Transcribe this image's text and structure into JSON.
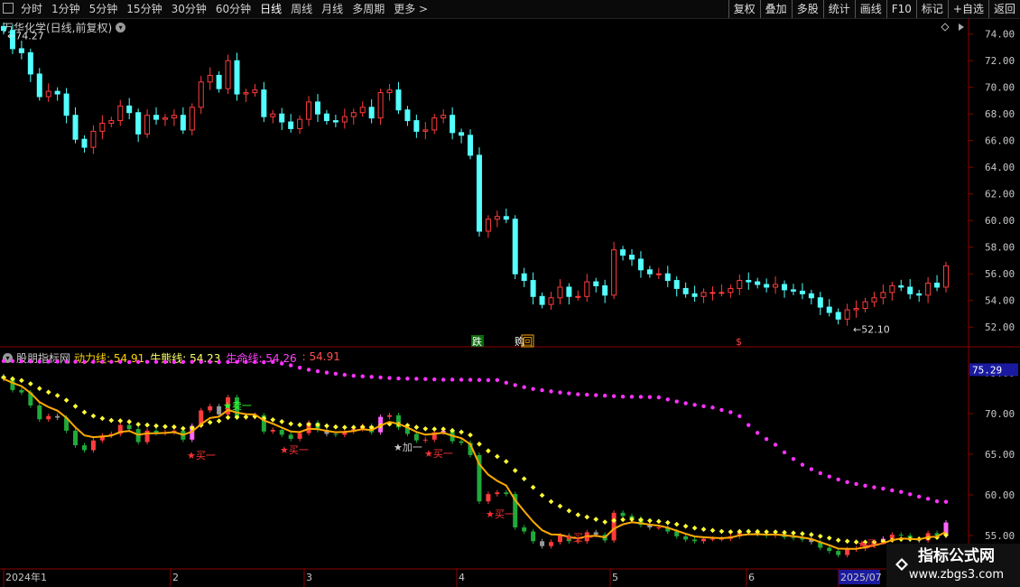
{
  "toolbar": {
    "periods": [
      "分时",
      "1分钟",
      "5分钟",
      "15分钟",
      "30分钟",
      "60分钟",
      "日线",
      "周线",
      "月线",
      "多周期",
      "更多"
    ],
    "active": "日线",
    "more_symbol": ">",
    "actions": [
      "复权",
      "叠加",
      "多股",
      "统计",
      "画线",
      "F10",
      "标记",
      "+自选",
      "返回"
    ]
  },
  "main_pane": {
    "stock_name": "万华化学(日线,前复权)",
    "high_label": "74.27",
    "low_label": "52.10",
    "markers": [
      "跌",
      "购",
      "回",
      "$"
    ],
    "y_ticks": [
      "74.00",
      "72.00",
      "70.00",
      "68.00",
      "66.00",
      "64.00",
      "62.00",
      "60.00",
      "58.00",
      "56.00",
      "54.00",
      "52.00"
    ]
  },
  "indicator_pane": {
    "name": "股朋指标网",
    "lines": [
      {
        "label": "动力线:",
        "value": "54.91",
        "color": "#ffd700"
      },
      {
        "label": "牛熊线:",
        "value": "54.23",
        "color": "#ffff66"
      },
      {
        "label": "生命线:",
        "value": "54.26",
        "color": "#ff40ff"
      },
      {
        "label": ":",
        "value": "54.91",
        "color": "#ff4d4d"
      }
    ],
    "current_value": "75.29",
    "y_ticks": [
      "75.00",
      "70.00",
      "65.00",
      "60.00",
      "55.00"
    ],
    "signals": {
      "sell": "卖一",
      "buy": "买一",
      "add": "加一",
      "sell_star": "★",
      "buy_star": "★"
    }
  },
  "x_axis": {
    "labels": [
      "2024年1",
      "2",
      "3",
      "4",
      "5",
      "6",
      "2025/07"
    ]
  },
  "watermark": {
    "title": "指标公式网",
    "url": "www.zbgs3.com"
  },
  "colors": {
    "up": "#ff3c3c",
    "down": "#54ffff",
    "axis": "#8b0000",
    "dynamic": "#ffaa00",
    "bull": "#ffff33",
    "life": "#ff33ff"
  },
  "chart_data": {
    "type": "candlestick",
    "ylim_price": [
      51.2,
      75.2
    ],
    "ylim_indicator": [
      52,
      76
    ],
    "candles_close": [
      74.27,
      72.9,
      72.6,
      71.0,
      69.3,
      69.7,
      69.5,
      67.9,
      66.1,
      65.5,
      66.7,
      67.3,
      67.5,
      68.6,
      68.1,
      66.5,
      67.9,
      67.6,
      67.7,
      67.9,
      66.8,
      68.5,
      70.4,
      70.9,
      69.9,
      72.0,
      69.5,
      69.6,
      69.8,
      67.8,
      68.0,
      67.4,
      66.9,
      67.6,
      68.9,
      68.0,
      67.5,
      67.4,
      67.8,
      68.1,
      68.5,
      67.7,
      69.6,
      69.8,
      68.3,
      67.5,
      66.7,
      66.8,
      67.7,
      67.9,
      66.6,
      66.4,
      64.9,
      59.2,
      60.1,
      60.3,
      60.1,
      56.0,
      55.5,
      54.3,
      53.7,
      54.2,
      55.0,
      54.3,
      54.3,
      55.4,
      55.1,
      54.4,
      57.8,
      57.4,
      57.1,
      56.3,
      56.0,
      56.0,
      55.5,
      54.9,
      54.5,
      54.3,
      54.6,
      54.6,
      54.6,
      54.9,
      55.5,
      55.4,
      55.2,
      55.0,
      55.2,
      54.8,
      54.7,
      54.5,
      54.2,
      53.5,
      53.1,
      52.6,
      53.3,
      53.4,
      53.9,
      54.2,
      54.6,
      55.1,
      55.0,
      54.5,
      54.4,
      55.3,
      55.0,
      56.6
    ]
  }
}
